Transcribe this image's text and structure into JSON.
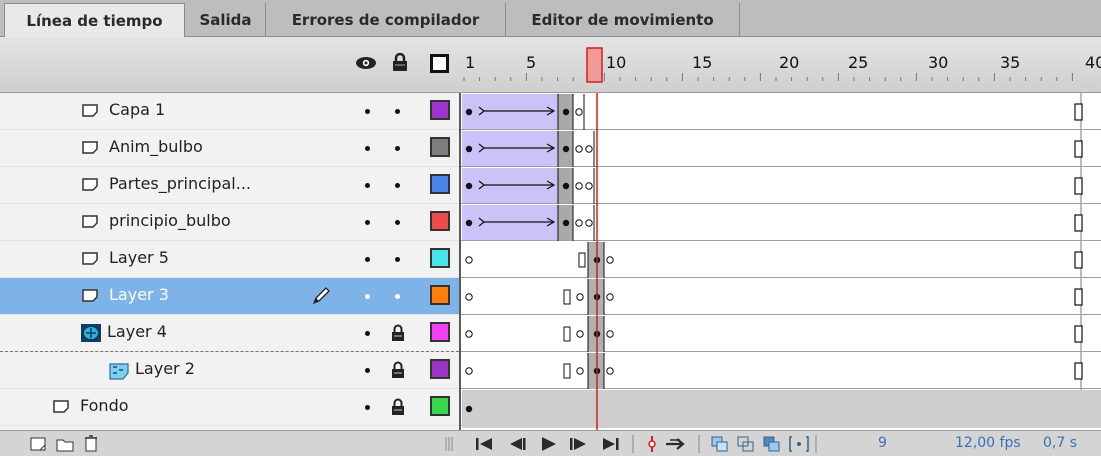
{
  "tabs": [
    {
      "label": "Línea de tiempo",
      "active": true
    },
    {
      "label": "Salida",
      "active": false
    },
    {
      "label": "Errores de compilador",
      "active": false
    },
    {
      "label": "Editor de movimiento",
      "active": false
    }
  ],
  "header": {
    "icons": [
      "eye-icon",
      "lock-icon",
      "outline-icon"
    ],
    "ruler_numbers": [
      "1",
      "5",
      "10",
      "15",
      "20",
      "25",
      "30",
      "35",
      "40"
    ]
  },
  "layers": [
    {
      "name": "Capa 1",
      "color": "#a033cc",
      "locked": false,
      "selected": false,
      "type": "normal"
    },
    {
      "name": "Anim_bulbo",
      "color": "#7d7d7d",
      "locked": false,
      "selected": false,
      "type": "normal"
    },
    {
      "name": "Partes_principal...",
      "color": "#4b82e8",
      "locked": false,
      "selected": false,
      "type": "normal"
    },
    {
      "name": "principio_bulbo",
      "color": "#ee4a4a",
      "locked": false,
      "selected": false,
      "type": "normal"
    },
    {
      "name": "Layer 5",
      "color": "#46e6ec",
      "locked": false,
      "selected": false,
      "type": "normal"
    },
    {
      "name": "Layer 3",
      "color": "#ff7f0e",
      "locked": false,
      "selected": true,
      "type": "normal"
    },
    {
      "name": "Layer 4",
      "color": "#f040f0",
      "locked": true,
      "selected": false,
      "type": "mask"
    },
    {
      "name": "Layer 2",
      "color": "#9a33c6",
      "locked": true,
      "selected": false,
      "type": "masked"
    },
    {
      "name": "Fondo",
      "color": "#36d94a",
      "locked": true,
      "selected": false,
      "type": "normal"
    }
  ],
  "status": {
    "current_frame": "9",
    "fps": "12,00 fps",
    "time": "0,7 s"
  }
}
